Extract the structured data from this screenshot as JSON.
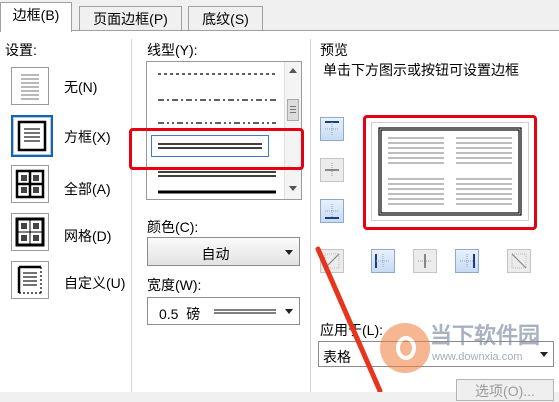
{
  "tabs": [
    {
      "label": "边框(B)"
    },
    {
      "label": "页面边框(P)"
    },
    {
      "label": "底纹(S)"
    }
  ],
  "settings": {
    "heading": "设置:",
    "items": [
      {
        "label": "无(N)",
        "icon": "no-border-icon"
      },
      {
        "label": "方框(X)",
        "icon": "box-border-icon",
        "selected": true
      },
      {
        "label": "全部(A)",
        "icon": "all-borders-icon"
      },
      {
        "label": "网格(D)",
        "icon": "grid-border-icon"
      },
      {
        "label": "自定义(U)",
        "icon": "custom-border-icon"
      }
    ]
  },
  "line_style": {
    "label": "线型(Y):",
    "selected_style": "double-thin"
  },
  "color": {
    "label": "颜色(C):",
    "value": "自动"
  },
  "width": {
    "label": "宽度(W):",
    "value": "0.5  磅"
  },
  "preview": {
    "heading": "预览",
    "hint": "单击下方图示或按钮可设置边框"
  },
  "apply_to": {
    "label": "应用于(L):",
    "value": "表格"
  },
  "options_button": {
    "label": "选项(O)..."
  },
  "watermark": {
    "name": "当下软件园",
    "url": "www.downxia.com"
  },
  "colors": {
    "highlight_red": "#e60012",
    "selection_blue": "#1b62b5",
    "arrow_red": "#e8341c"
  }
}
